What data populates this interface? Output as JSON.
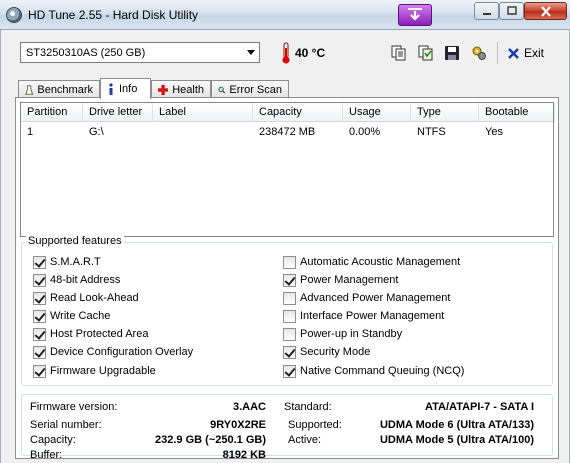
{
  "window": {
    "title": "HD Tune 2.55 - Hard Disk Utility",
    "icons": [
      "app-icon",
      "download-icon",
      "minimize-icon",
      "maximize-icon",
      "close-icon"
    ]
  },
  "toolbar": {
    "drive": "ST3250310AS (250 GB)",
    "temperature": "40 °C",
    "exit_label": "Exit",
    "icons": [
      "copy-text-icon",
      "copy-info-icon",
      "save-icon",
      "options-icon",
      "exit-icon"
    ]
  },
  "tabs": [
    {
      "label": "Benchmark",
      "icon": "benchmark-icon"
    },
    {
      "label": "Info",
      "icon": "info-icon",
      "active": true
    },
    {
      "label": "Health",
      "icon": "health-icon"
    },
    {
      "label": "Error Scan",
      "icon": "search-icon"
    }
  ],
  "partitions": {
    "headers": [
      "Partition",
      "Drive letter",
      "Label",
      "Capacity",
      "Usage",
      "Type",
      "Bootable"
    ],
    "rows": [
      [
        "1",
        "G:\\",
        "",
        "238472 MB",
        "0.00%",
        "NTFS",
        "Yes"
      ]
    ]
  },
  "features": {
    "title": "Supported features",
    "left": [
      {
        "label": "S.M.A.R.T",
        "checked": true
      },
      {
        "label": "48-bit Address",
        "checked": true
      },
      {
        "label": "Read Look-Ahead",
        "checked": true
      },
      {
        "label": "Write Cache",
        "checked": true
      },
      {
        "label": "Host Protected Area",
        "checked": true
      },
      {
        "label": "Device Configuration Overlay",
        "checked": true
      },
      {
        "label": "Firmware Upgradable",
        "checked": true
      }
    ],
    "right": [
      {
        "label": "Automatic Acoustic Management",
        "checked": false
      },
      {
        "label": "Power Management",
        "checked": true
      },
      {
        "label": "Advanced Power Management",
        "checked": false
      },
      {
        "label": "Interface Power Management",
        "checked": false
      },
      {
        "label": "Power-up in Standby",
        "checked": false
      },
      {
        "label": "Security Mode",
        "checked": true
      },
      {
        "label": "Native Command Queuing (NCQ)",
        "checked": true
      }
    ]
  },
  "info": {
    "firmware_label": "Firmware version:",
    "firmware": "3.AAC",
    "serial_label": "Serial number:",
    "serial": "9RY0X2RE",
    "capacity_label": "Capacity:",
    "capacity": "232.9 GB (~250.1 GB)",
    "buffer_label": "Buffer:",
    "buffer": "8192 KB",
    "standard_label": "Standard:",
    "standard": "ATA/ATAPI-7 - SATA I",
    "supported_label": "Supported:",
    "supported": "UDMA Mode 6 (Ultra ATA/133)",
    "active_label": "Active:",
    "active": "UDMA Mode 5 (Ultra ATA/100)"
  }
}
